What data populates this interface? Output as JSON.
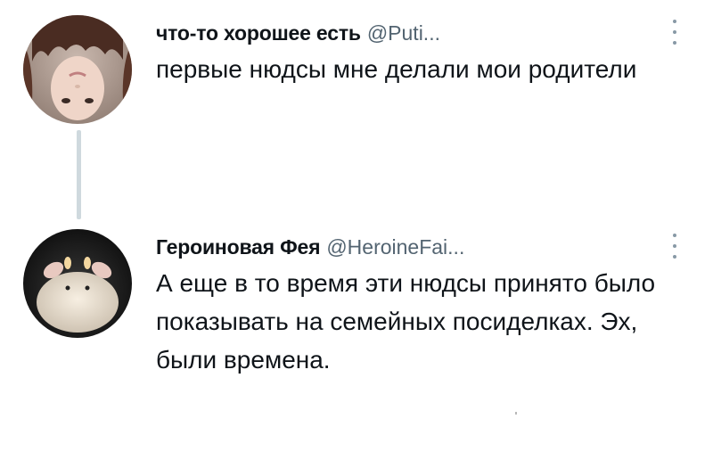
{
  "tweets": [
    {
      "display_name": "что-то хорошее есть",
      "handle": "@Puti...",
      "text": "первые нюдсы мне делали мои родители",
      "avatar_icon": "profile-photo-girl-upside-down",
      "more_icon": "more-options-icon"
    },
    {
      "display_name": "Героиновая Фея",
      "handle": "@HeroineFai...",
      "text": "А еще в то время эти нюдсы принято было показывать на семейных посиделках. Эх, были времена.",
      "avatar_icon": "profile-photo-plush-toy",
      "more_icon": "more-options-icon"
    }
  ],
  "colors": {
    "text_primary": "#0f1419",
    "text_secondary": "#536471",
    "thread_line": "#cfd9de",
    "background": "#ffffff"
  }
}
